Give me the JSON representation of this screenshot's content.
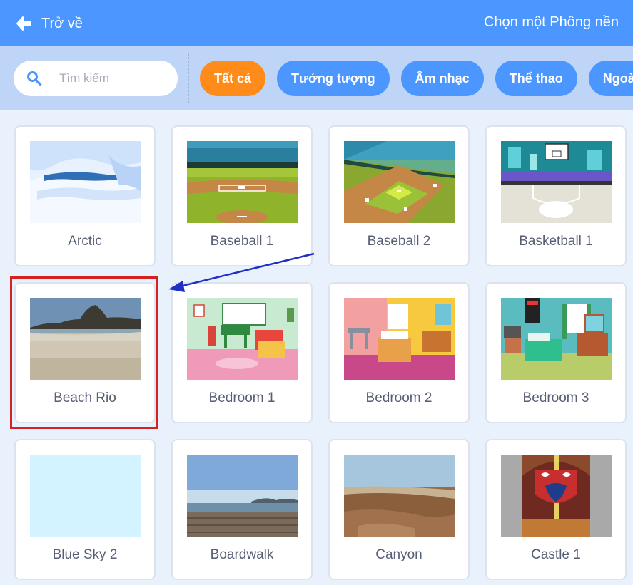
{
  "header": {
    "back_label": "Trở về",
    "title": "Chọn một Phông nền"
  },
  "search": {
    "placeholder": "Tìm kiếm"
  },
  "tags": [
    {
      "label": "Tất cả",
      "active": true
    },
    {
      "label": "Tưởng tượng",
      "active": false
    },
    {
      "label": "Âm nhạc",
      "active": false
    },
    {
      "label": "Thể thao",
      "active": false
    },
    {
      "label": "Ngoài trời",
      "active": false
    }
  ],
  "backdrops": [
    {
      "name": "Arctic"
    },
    {
      "name": "Baseball 1"
    },
    {
      "name": "Baseball 2"
    },
    {
      "name": "Basketball 1"
    },
    {
      "name": "Beach Rio"
    },
    {
      "name": "Bedroom 1"
    },
    {
      "name": "Bedroom 2"
    },
    {
      "name": "Bedroom 3"
    },
    {
      "name": "Blue Sky 2"
    },
    {
      "name": "Boardwalk"
    },
    {
      "name": "Canyon"
    },
    {
      "name": "Castle 1"
    }
  ],
  "colors": {
    "header": "#4c97ff",
    "filter_bar": "#bed5f7",
    "active_tag": "#ff8c1a",
    "tag": "#4c97ff",
    "highlight_box": "#d42121",
    "annotation_arrow": "#1f2fc8"
  }
}
